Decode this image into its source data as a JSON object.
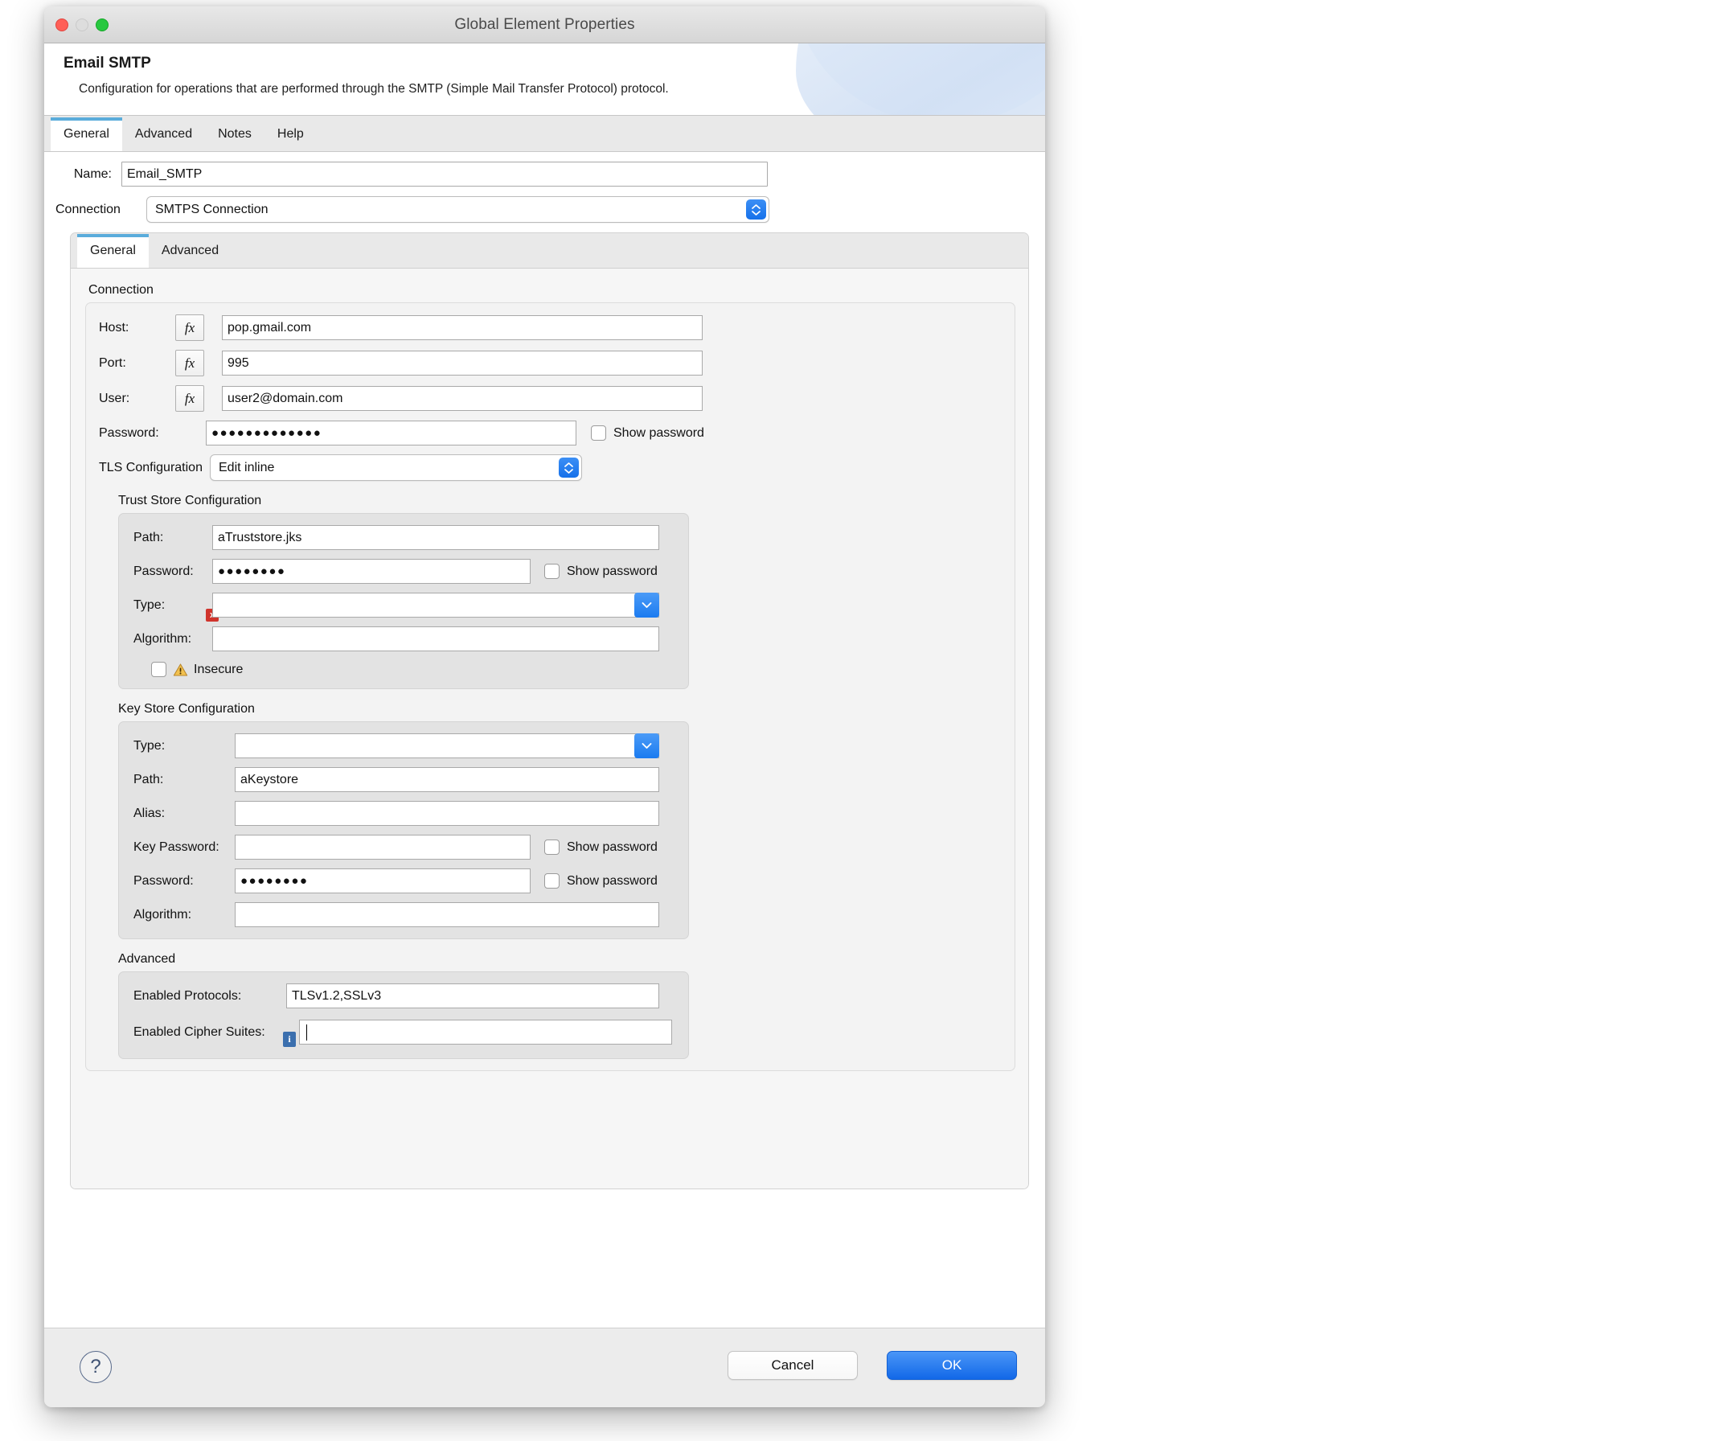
{
  "window": {
    "title": "Global Element Properties",
    "traffic_lights": [
      "close-red",
      "minimize-disabled",
      "zoom-green"
    ]
  },
  "header": {
    "title": "Email SMTP",
    "description": "Configuration for operations that are performed through the SMTP (Simple Mail Transfer Protocol) protocol."
  },
  "outer_tabs": [
    {
      "label": "General",
      "active": true
    },
    {
      "label": "Advanced",
      "active": false
    },
    {
      "label": "Notes",
      "active": false
    },
    {
      "label": "Help",
      "active": false
    }
  ],
  "general": {
    "name_label": "Name:",
    "name_value": "Email_SMTP",
    "connection_label": "Connection",
    "connection_value": "SMTPS Connection"
  },
  "inner_tabs": [
    {
      "label": "General",
      "active": true
    },
    {
      "label": "Advanced",
      "active": false
    }
  ],
  "connection_group": {
    "title": "Connection",
    "host_label": "Host:",
    "host_value": "pop.gmail.com",
    "port_label": "Port:",
    "port_value": "995",
    "user_label": "User:",
    "user_value": "user2@domain.com",
    "password_label": "Password:",
    "password_value": "●●●●●●●●●●●●●",
    "show_password_label": "Show password",
    "show_password_checked": false,
    "tls_label": "TLS Configuration",
    "tls_value": "Edit inline",
    "fx_label": "fx"
  },
  "trust_store": {
    "title": "Trust Store Configuration",
    "path_label": "Path:",
    "path_value": "aTruststore.jks",
    "password_label": "Password:",
    "password_value": "●●●●●●●●",
    "show_password_label": "Show password",
    "show_password_checked": false,
    "type_label": "Type:",
    "type_value": "",
    "type_error_badge": "x",
    "algorithm_label": "Algorithm:",
    "algorithm_value": "",
    "insecure_label": "Insecure",
    "insecure_checked": false
  },
  "key_store": {
    "title": "Key Store Configuration",
    "type_label": "Type:",
    "type_value": "",
    "path_label": "Path:",
    "path_value": "aKeystore",
    "alias_label": "Alias:",
    "alias_value": "",
    "key_password_label": "Key Password:",
    "key_password_value": "",
    "key_password_show_label": "Show password",
    "password_label": "Password:",
    "password_value": "●●●●●●●●",
    "password_show_label": "Show password"
  },
  "advanced": {
    "title": "Advanced",
    "protocols_label": "Enabled Protocols:",
    "protocols_value": "TLSv1.2,SSLv3",
    "cipher_label": "Enabled Cipher Suites:",
    "cipher_value": "",
    "cipher_info_badge": "i"
  },
  "footer": {
    "help_label": "?",
    "cancel_label": "Cancel",
    "ok_label": "OK"
  },
  "colors": {
    "accent_blue": "#1b7bf0",
    "tab_indicator": "#5aacdb",
    "error_red": "#d0342c",
    "warning_amber": "#e8a33d",
    "info_blue": "#3b6fae"
  }
}
